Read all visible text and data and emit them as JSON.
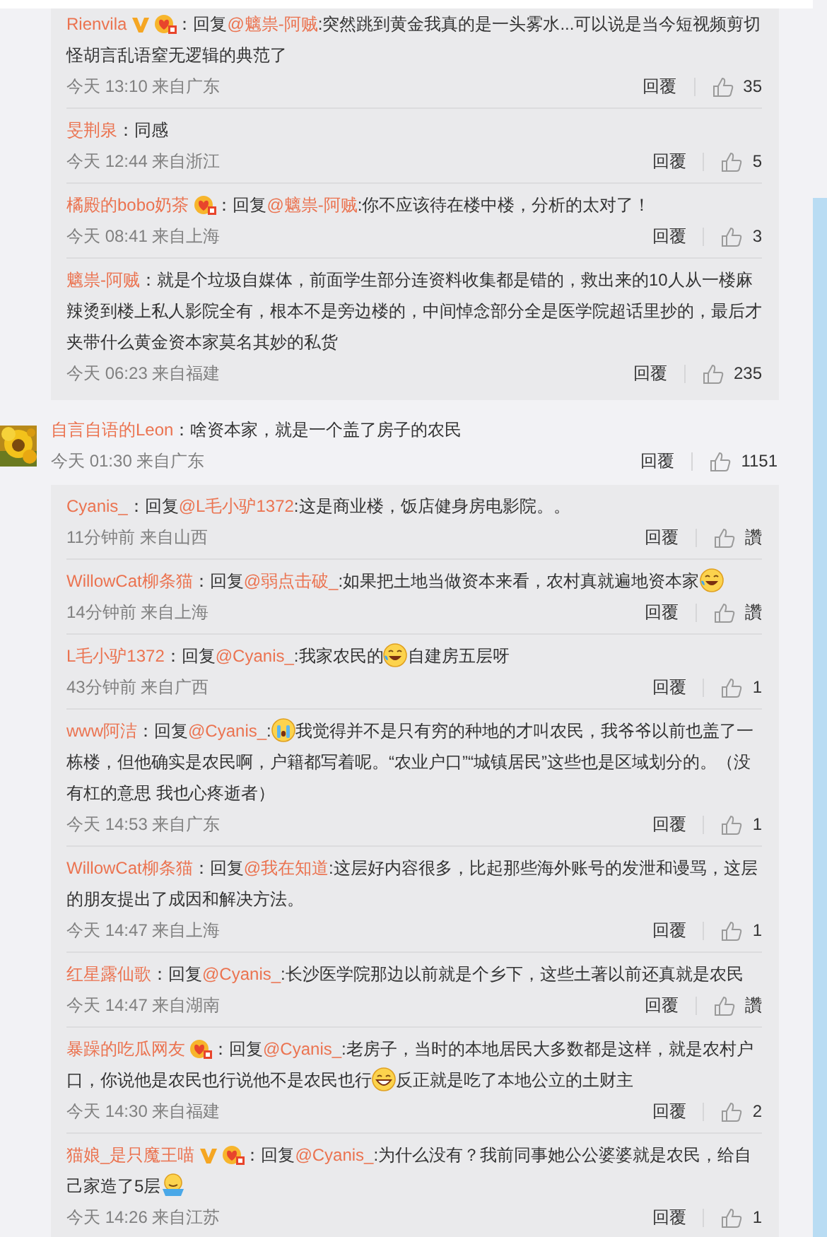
{
  "items": [
    {
      "kind": "reply_box",
      "cut_top": true,
      "replies": [
        {
          "author": "Rienvila",
          "verified": true,
          "fan_badge": true,
          "parts": [
            {
              "kind": "text",
              "text": "：回复"
            },
            {
              "kind": "mention",
              "text": "@魑祟-阿贼"
            },
            {
              "kind": "text",
              "text": ":突然跳到黄金我真的是一头雾水...可以说是当今短视频剪切怪胡言乱语窒无逻辑的典范了"
            }
          ],
          "time": "今天 13:10 来自广东",
          "reply_label": "回覆",
          "likes": "35"
        },
        {
          "author": "旻荆泉",
          "parts": [
            {
              "kind": "text",
              "text": "：同感"
            }
          ],
          "time": "今天 12:44 来自浙江",
          "reply_label": "回覆",
          "likes": "5"
        },
        {
          "author": "橘殿的bobo奶茶",
          "fan_badge": true,
          "parts": [
            {
              "kind": "text",
              "text": "：回复"
            },
            {
              "kind": "mention",
              "text": "@魑祟-阿贼"
            },
            {
              "kind": "text",
              "text": ":你不应该待在楼中楼，分析的太对了！"
            }
          ],
          "time": "今天 08:41 来自上海",
          "reply_label": "回覆",
          "likes": "3"
        },
        {
          "author": "魑祟-阿贼",
          "parts": [
            {
              "kind": "text",
              "text": "：就是个垃圾自媒体，前面学生部分连资料收集都是错的，救出来的10人从一楼麻辣烫到楼上私人影院全有，根本不是旁边楼的，中间悼念部分全是医学院超话里抄的，最后才夹带什么黄金资本家莫名其妙的私货"
            }
          ],
          "time": "今天 06:23 来自福建",
          "reply_label": "回覆",
          "likes": "235"
        }
      ]
    },
    {
      "kind": "comment",
      "author": "自言自语的Leon",
      "parts": [
        {
          "kind": "text",
          "text": "：啥资本家，就是一个盖了房子的农民"
        }
      ],
      "time": "今天 01:30 来自广东",
      "reply_label": "回覆",
      "likes": "1151"
    },
    {
      "kind": "reply_box",
      "cut_top": false,
      "replies": [
        {
          "author": "Cyanis_",
          "parts": [
            {
              "kind": "text",
              "text": "：回复"
            },
            {
              "kind": "mention",
              "text": "@L毛小驴1372"
            },
            {
              "kind": "text",
              "text": ":这是商业楼，饭店健身房电影院。。"
            }
          ],
          "time": "11分钟前 来自山西",
          "reply_label": "回覆",
          "likes": "讚"
        },
        {
          "author": "WillowCat柳条猫",
          "parts": [
            {
              "kind": "text",
              "text": "：回复"
            },
            {
              "kind": "mention",
              "text": "@弱点击破_"
            },
            {
              "kind": "text",
              "text": ":如果把土地当做资本来看，农村真就遍地资本家"
            },
            {
              "kind": "laugh-cry"
            }
          ],
          "time": "14分钟前 来自上海",
          "reply_label": "回覆",
          "likes": "讚"
        },
        {
          "author": "L毛小驴1372",
          "parts": [
            {
              "kind": "text",
              "text": "：回复"
            },
            {
              "kind": "mention",
              "text": "@Cyanis_"
            },
            {
              "kind": "text",
              "text": ":我家农民的"
            },
            {
              "kind": "laugh-cry"
            },
            {
              "kind": "text",
              "text": "自建房五层呀"
            }
          ],
          "time": "43分钟前 来自广西",
          "reply_label": "回覆",
          "likes": "1"
        },
        {
          "author": "www阿洁",
          "parts": [
            {
              "kind": "text",
              "text": "：回复"
            },
            {
              "kind": "mention",
              "text": "@Cyanis_"
            },
            {
              "kind": "text",
              "text": ":"
            },
            {
              "kind": "crying"
            },
            {
              "kind": "text",
              "text": "我觉得并不是只有穷的种地的才叫农民，我爷爷以前也盖了一栋楼，但他确实是农民啊，户籍都写着呢。“农业户口”“城镇居民”这些也是区域划分的。（没有杠的意思 我也心疼逝者）"
            }
          ],
          "time": "今天 14:53 来自广东",
          "reply_label": "回覆",
          "likes": "1"
        },
        {
          "author": "WillowCat柳条猫",
          "parts": [
            {
              "kind": "text",
              "text": "：回复"
            },
            {
              "kind": "mention",
              "text": "@我在知道"
            },
            {
              "kind": "text",
              "text": ":这层好内容很多，比起那些海外账号的发泄和谩骂，这层的朋友提出了成因和解决方法。"
            }
          ],
          "time": "今天 14:47 来自上海",
          "reply_label": "回覆",
          "likes": "1"
        },
        {
          "author": "红星露仙歌",
          "parts": [
            {
              "kind": "text",
              "text": "：回复"
            },
            {
              "kind": "mention",
              "text": "@Cyanis_"
            },
            {
              "kind": "text",
              "text": ":长沙医学院那边以前就是个乡下，这些土著以前还真就是农民"
            }
          ],
          "time": "今天 14:47 来自湖南",
          "reply_label": "回覆",
          "likes": "讚"
        },
        {
          "author": "暴躁的吃瓜网友",
          "fan_badge": true,
          "parts": [
            {
              "kind": "text",
              "text": "：回复"
            },
            {
              "kind": "mention",
              "text": "@Cyanis_"
            },
            {
              "kind": "text",
              "text": ":老房子，当时的本地居民大多数都是这样，就是农村户口，你说他是农民也行说他不是农民也行"
            },
            {
              "kind": "grin"
            },
            {
              "kind": "text",
              "text": "反正就是吃了本地公立的土财主"
            }
          ],
          "time": "今天 14:30 来自福建",
          "reply_label": "回覆",
          "likes": "2"
        },
        {
          "author": "猫娘_是只魔王喵",
          "verified": true,
          "fan_badge": true,
          "parts": [
            {
              "kind": "text",
              "text": "：回复"
            },
            {
              "kind": "mention",
              "text": "@Cyanis_"
            },
            {
              "kind": "text",
              "text": ":为什么没有？我前同事她公公婆婆就是农民，给自己家造了5层"
            },
            {
              "kind": "shrug"
            }
          ],
          "time": "今天 14:26 来自江苏",
          "reply_label": "回覆",
          "likes": "1"
        }
      ]
    }
  ]
}
